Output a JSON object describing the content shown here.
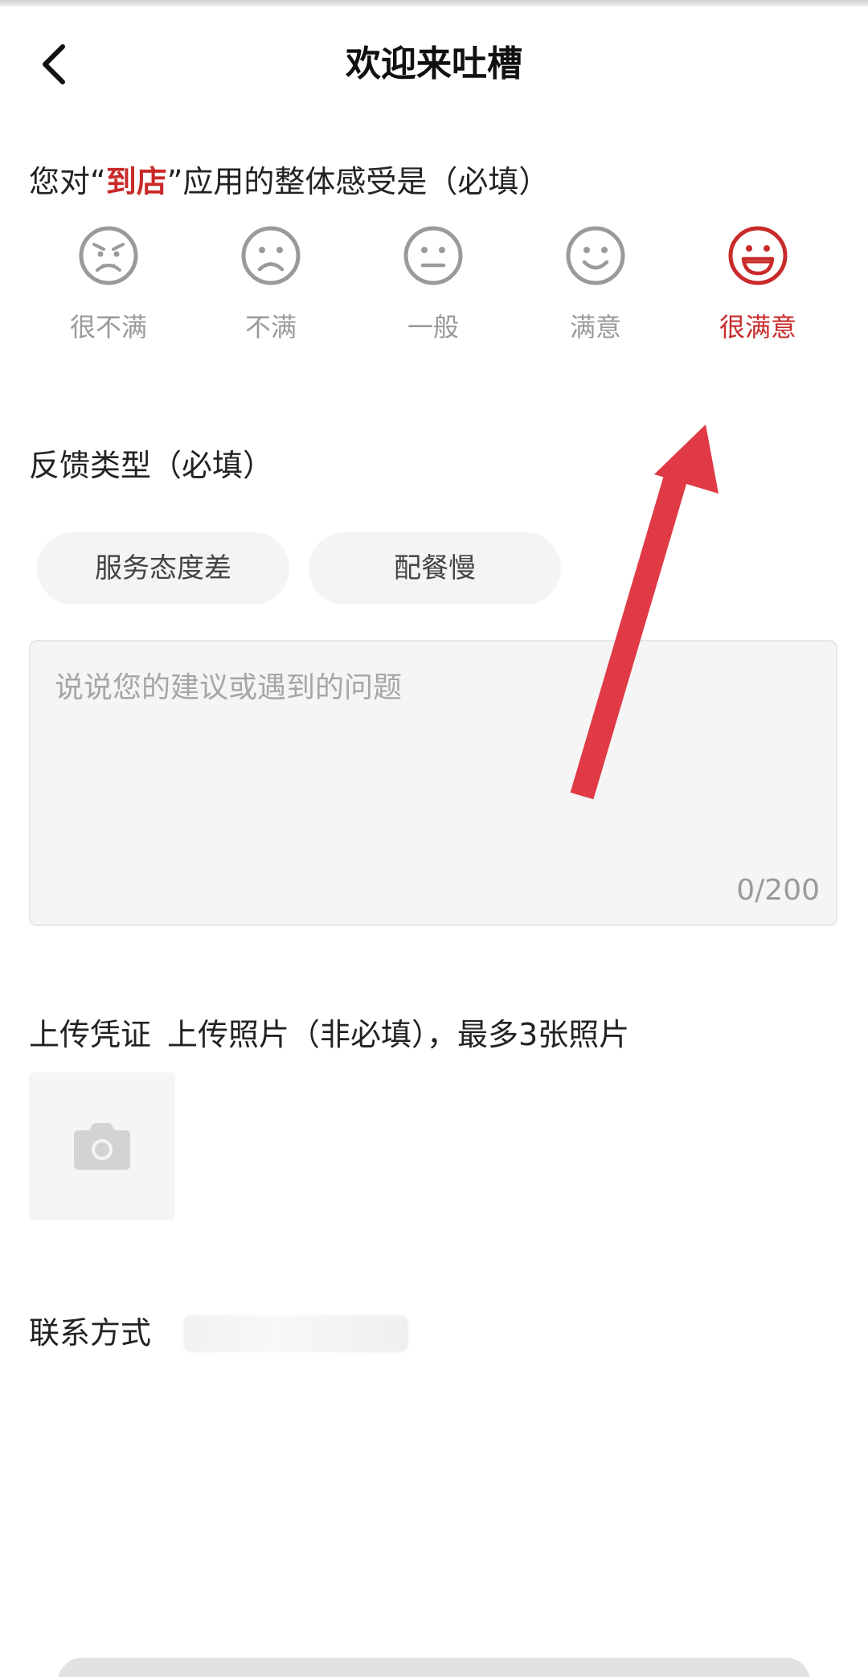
{
  "header": {
    "title": "欢迎来吐槽",
    "back_icon": "chevron-left-icon"
  },
  "rating": {
    "question_prefix": "您对“",
    "question_highlight": "到店",
    "question_suffix": "”应用的整体感受是（必填）",
    "highlight_color": "#c92a2a",
    "options": [
      {
        "label": "很不满",
        "icon": "very-unhappy-face-icon",
        "selected": false
      },
      {
        "label": "不满",
        "icon": "unhappy-face-icon",
        "selected": false
      },
      {
        "label": "一般",
        "icon": "neutral-face-icon",
        "selected": false
      },
      {
        "label": "满意",
        "icon": "happy-face-icon",
        "selected": false
      },
      {
        "label": "很满意",
        "icon": "very-happy-face-icon",
        "selected": true
      }
    ]
  },
  "feedback_type": {
    "title": "反馈类型（必填）",
    "chips": [
      "服务态度差",
      "配餐慢"
    ]
  },
  "textarea": {
    "placeholder": "说说您的建议或遇到的问题",
    "value": "",
    "counter": "0/200"
  },
  "upload": {
    "title": "上传凭证",
    "hint": "上传照片（非必填），最多3张照片",
    "icon": "camera-icon"
  },
  "contact": {
    "label": "联系方式",
    "value": ""
  },
  "annotation": {
    "color": "#e03a46"
  }
}
